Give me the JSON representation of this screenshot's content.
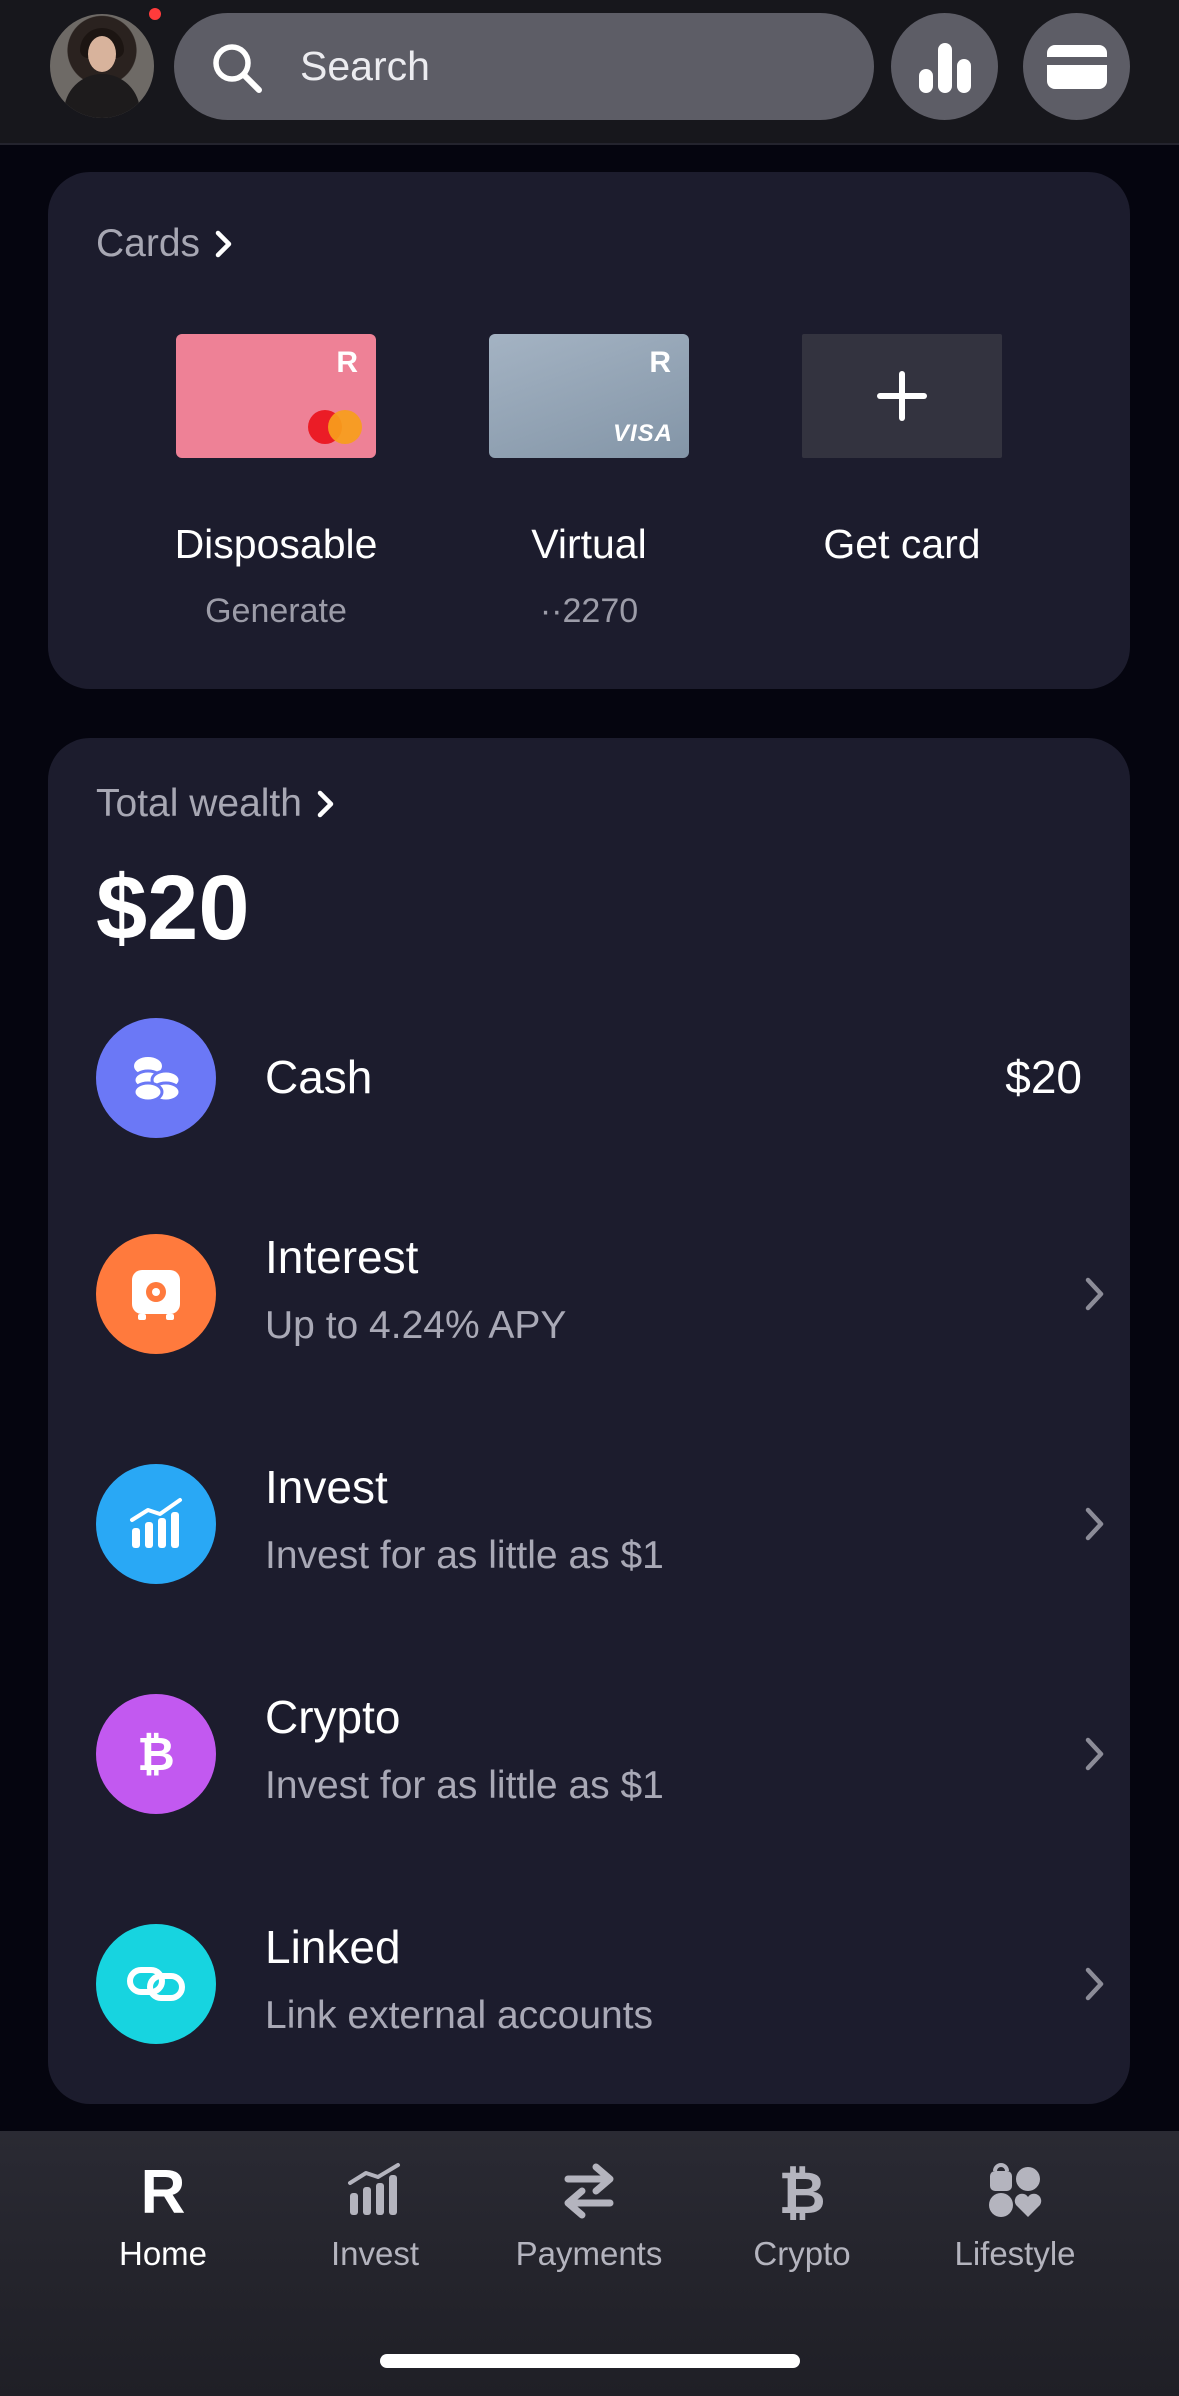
{
  "header": {
    "search_placeholder": "Search"
  },
  "cards": {
    "title": "Cards",
    "items": [
      {
        "label": "Disposable",
        "sub": "Generate",
        "color": "#ee8196",
        "brand": "mastercard"
      },
      {
        "label": "Virtual",
        "sub": "··2270",
        "color": "#94a5b7",
        "brand": "VISA"
      },
      {
        "label": "Get card",
        "sub": ""
      }
    ]
  },
  "wealth": {
    "title": "Total wealth",
    "amount": "$20",
    "accounts": [
      {
        "name": "Cash",
        "value": "$20",
        "icon": "coins-icon",
        "color": "#6b78f6"
      },
      {
        "name": "Interest",
        "sub": "Up to 4.24% APY",
        "icon": "vault-icon",
        "color": "#ff7a3d"
      },
      {
        "name": "Invest",
        "sub": "Invest for as little as $1",
        "icon": "invest-chart-icon",
        "color": "#29a8f5"
      },
      {
        "name": "Crypto",
        "sub": "Invest for as little as $1",
        "icon": "bitcoin-icon",
        "color": "#c259f0"
      },
      {
        "name": "Linked",
        "sub": "Link external accounts",
        "icon": "link-icon",
        "color": "#17d4e0"
      }
    ]
  },
  "nav": {
    "items": [
      {
        "label": "Home",
        "icon": "revolut-r-icon",
        "active": true
      },
      {
        "label": "Invest",
        "icon": "invest-bars-icon"
      },
      {
        "label": "Payments",
        "icon": "transfer-arrows-icon"
      },
      {
        "label": "Crypto",
        "icon": "bitcoin-icon"
      },
      {
        "label": "Lifestyle",
        "icon": "lifestyle-icon"
      }
    ]
  },
  "logo_letters": {
    "card_brand_letter": "R",
    "visa": "VISA"
  }
}
